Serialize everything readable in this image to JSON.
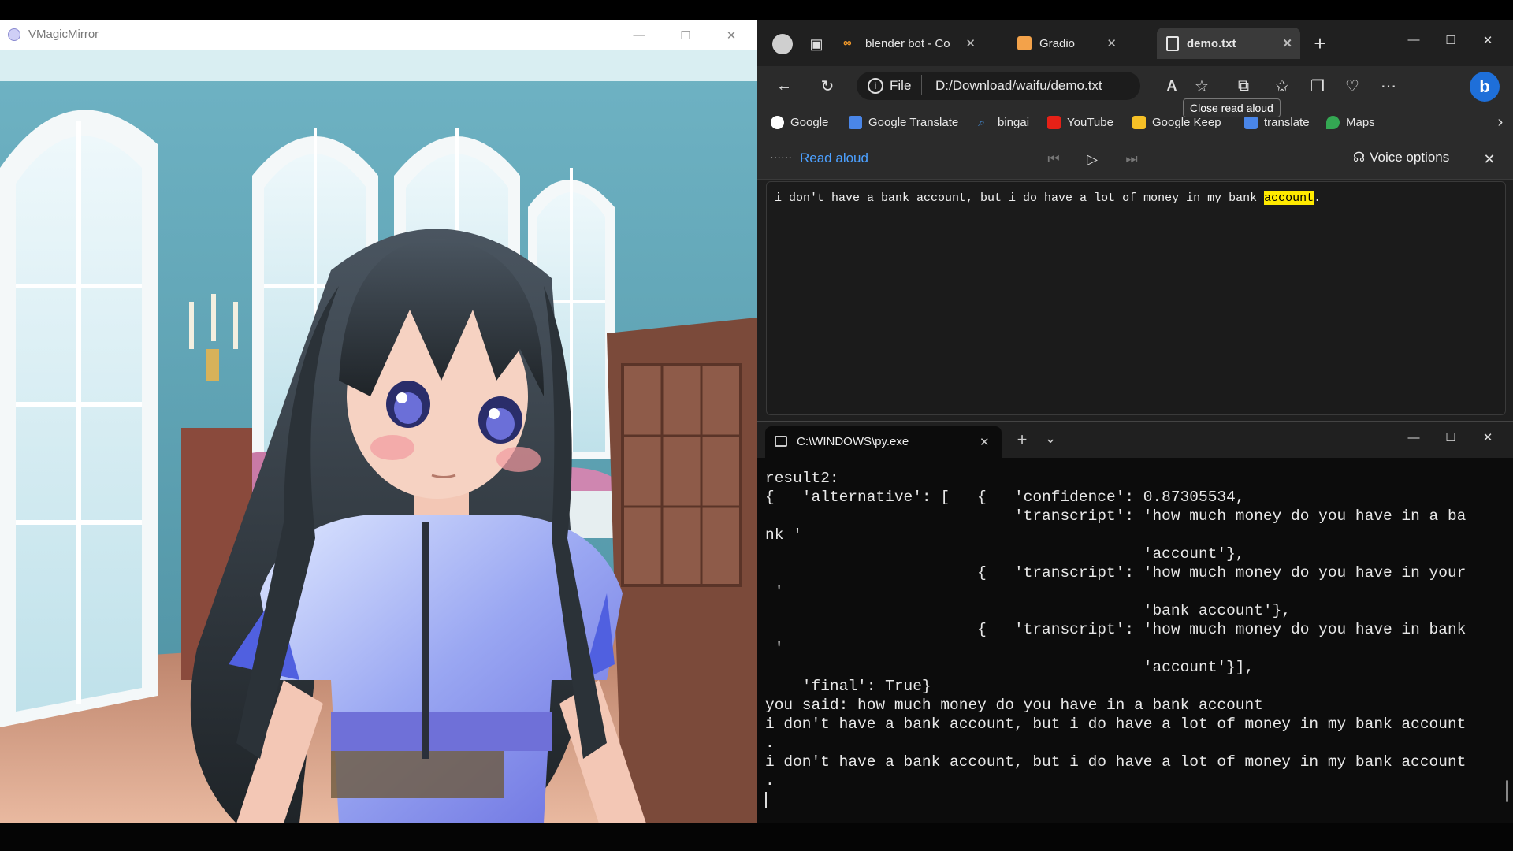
{
  "vmm": {
    "title": "VMagicMirror",
    "minimize": "—",
    "maximize": "☐",
    "close": "✕"
  },
  "edge": {
    "tabs": [
      {
        "label": "blender bot - Co",
        "close": "✕"
      },
      {
        "label": "Gradio",
        "close": "✕"
      },
      {
        "label": "demo.txt",
        "close": "✕"
      }
    ],
    "new_tab": "+",
    "win": {
      "minimize": "—",
      "maximize": "☐",
      "close": "✕"
    },
    "address": {
      "scheme_label": "File",
      "path": "D:/Download/waifu/demo.txt"
    },
    "tooltip": "Close read aloud",
    "bookmarks": [
      "Google",
      "Google Translate",
      "bingai",
      "YouTube",
      "Google Keep",
      "translate",
      "Maps"
    ],
    "read_aloud": {
      "label": "Read aloud",
      "voice_options": "Voice options"
    },
    "document": {
      "text_before": "i don't have a bank account, but i do have a lot of money in my bank ",
      "highlight": "account",
      "text_after": "."
    }
  },
  "terminal": {
    "tab_title": "C:\\WINDOWS\\py.exe",
    "tab_close": "✕",
    "new_tab": "+",
    "dropdown": "⌄",
    "win": {
      "minimize": "—",
      "maximize": "☐",
      "close": "✕"
    },
    "lines": [
      "result2:",
      "{   'alternative': [   {   'confidence': 0.87305534,",
      "                           'transcript': 'how much money do you have in a ba",
      "nk '",
      "                                         'account'},",
      "                       {   'transcript': 'how much money do you have in your",
      " '",
      "                                         'bank account'},",
      "                       {   'transcript': 'how much money do you have in bank",
      " '",
      "                                         'account'}],",
      "    'final': True}",
      "you said: how much money do you have in a bank account",
      "i don't have a bank account, but i do have a lot of money in my bank account",
      ".",
      "i don't have a bank account, but i do have a lot of money in my bank account",
      "."
    ]
  }
}
